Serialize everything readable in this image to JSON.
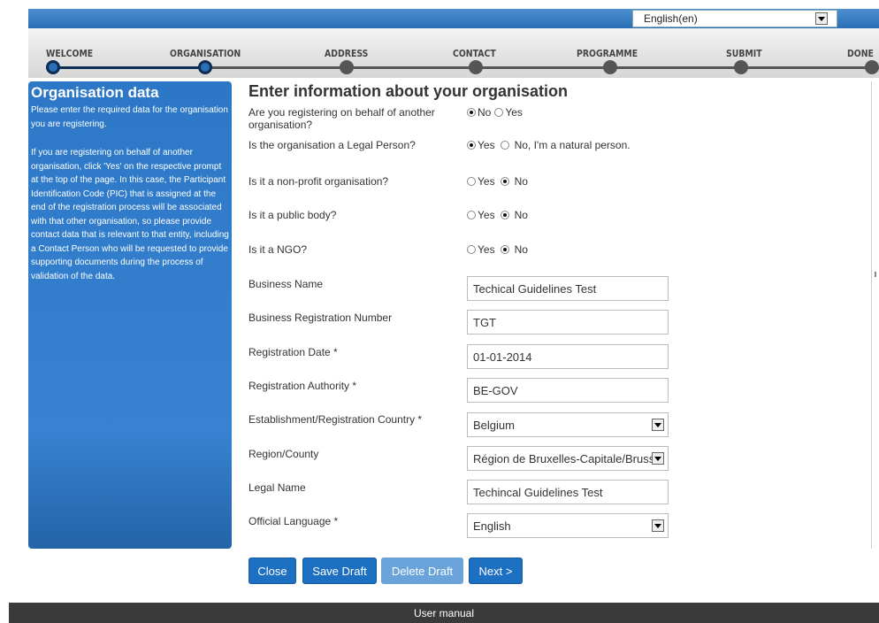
{
  "language_select": {
    "value": "English(en)"
  },
  "steps": [
    "WELCOME",
    "ORGANISATION",
    "ADDRESS",
    "CONTACT",
    "PROGRAMME",
    "SUBMIT",
    "DONE"
  ],
  "sidebar": {
    "title": "Organisation data",
    "para1": "Please enter the required data for the organisation you are registering.",
    "para2": "If you are registering on behalf of another organisation, click 'Yes' on the respective prompt at the top of the page. In this case, the Participant Identification Code (PIC) that is assigned at the end of the registration process will be associated with that other organisation, so please provide contact data that is relevant to that entity, including a Contact Person who will be requested to provide supporting documents during the process of validation of the data."
  },
  "form": {
    "heading": "Enter information about your organisation",
    "questions": [
      {
        "label": "Are you registering on behalf of another organisation?",
        "opt1": "No",
        "opt2": "Yes",
        "selected": 1
      },
      {
        "label": "Is the organisation a Legal Person?",
        "opt1": "Yes",
        "opt2": "No, I'm a natural person.",
        "selected": 1
      },
      {
        "label": "Is it a non-profit organisation?",
        "opt1": "Yes",
        "opt2": "No",
        "selected": 2
      },
      {
        "label": "Is it a public body?",
        "opt1": "Yes",
        "opt2": "No",
        "selected": 2
      },
      {
        "label": "Is it a NGO?",
        "opt1": "Yes",
        "opt2": "No",
        "selected": 2
      }
    ],
    "fields": [
      {
        "label": "Business Name",
        "value": "Techical Guidelines Test",
        "type": "text"
      },
      {
        "label": "Business Registration Number",
        "value": "TGT",
        "type": "text"
      },
      {
        "label": "Registration Date *",
        "value": "01-01-2014",
        "type": "text"
      },
      {
        "label": "Registration Authority *",
        "value": "BE-GOV",
        "type": "text"
      },
      {
        "label": "Establishment/Registration Country *",
        "value": "Belgium",
        "type": "select"
      },
      {
        "label": "Region/County",
        "value": "Région de Bruxelles-Capitale/Brussels",
        "type": "select"
      },
      {
        "label": "Legal Name",
        "value": "Techincal Guidelines Test",
        "type": "text"
      },
      {
        "label": "Official Language *",
        "value": "English",
        "type": "select"
      }
    ]
  },
  "buttons": {
    "close": "Close",
    "save_draft": "Save Draft",
    "delete_draft": "Delete Draft",
    "next": "Next >"
  },
  "footer": {
    "link": "User manual"
  },
  "colors": {
    "accent": "#2a6fb6",
    "sidebar": "#3783d1",
    "footer": "#3a3a3a"
  }
}
